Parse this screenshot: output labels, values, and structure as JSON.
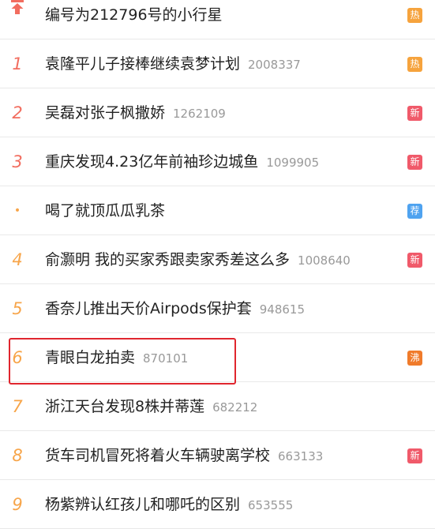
{
  "colors": {
    "rank_top": "#f26d5f",
    "rank_other": "#f7a54a",
    "badge_hot": "#f6a33d",
    "badge_new": "#f05a6a",
    "badge_recommend": "#4fa3f0",
    "badge_boil": "#f07b2b",
    "highlight_box": "#e0262e"
  },
  "items": [
    {
      "rank": "",
      "icon": "pinned-top-icon",
      "title": "编号为212796号的小行星",
      "count": "",
      "badge": "热",
      "badge_type": "hot"
    },
    {
      "rank": "1",
      "title": "袁隆平儿子接棒继续袁梦计划",
      "count": "2008337",
      "badge": "热",
      "badge_type": "hot"
    },
    {
      "rank": "2",
      "title": "吴磊对张子枫撒娇",
      "count": "1262109",
      "badge": "新",
      "badge_type": "new"
    },
    {
      "rank": "3",
      "title": "重庆发现4.23亿年前袖珍边城鱼",
      "count": "1099905",
      "badge": "新",
      "badge_type": "new"
    },
    {
      "rank": "•",
      "title": "喝了就顶瓜瓜乳茶",
      "count": "",
      "badge": "荐",
      "badge_type": "recommend"
    },
    {
      "rank": "4",
      "title": "俞灏明 我的买家秀跟卖家秀差这么多",
      "count": "1008640",
      "badge": "新",
      "badge_type": "new"
    },
    {
      "rank": "5",
      "title": "香奈儿推出天价Airpods保护套",
      "count": "948615",
      "badge": "",
      "badge_type": ""
    },
    {
      "rank": "6",
      "title": "青眼白龙拍卖",
      "count": "870101",
      "badge": "沸",
      "badge_type": "boil"
    },
    {
      "rank": "7",
      "title": "浙江天台发现8株并蒂莲",
      "count": "682212",
      "badge": "",
      "badge_type": ""
    },
    {
      "rank": "8",
      "title": "货车司机冒死将着火车辆驶离学校",
      "count": "663133",
      "badge": "新",
      "badge_type": "new"
    },
    {
      "rank": "9",
      "title": "杨紫辨认红孩儿和哪吒的区别",
      "count": "653555",
      "badge": "",
      "badge_type": ""
    }
  ]
}
